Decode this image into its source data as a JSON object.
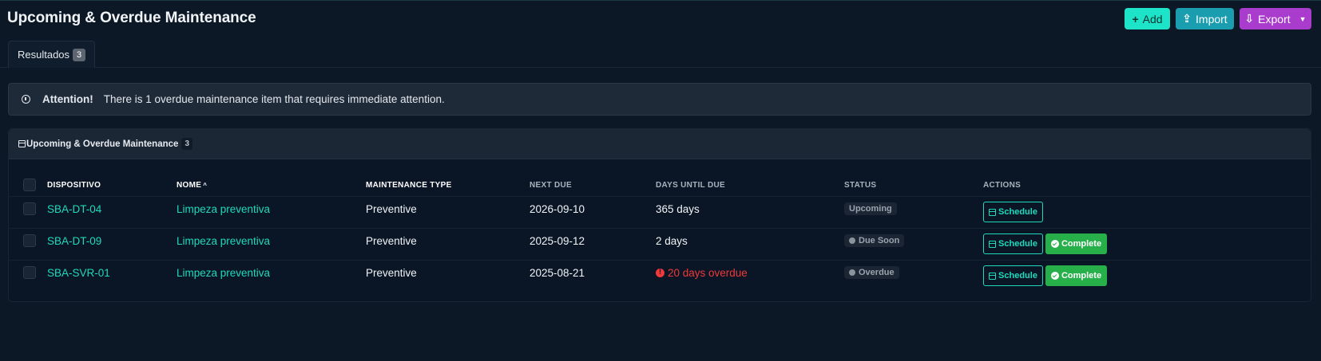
{
  "header": {
    "title": "Upcoming & Overdue Maintenance",
    "add_label": "Add",
    "import_label": "Import",
    "export_label": "Export"
  },
  "tabs": [
    {
      "label": "Resultados",
      "count": "3"
    }
  ],
  "alert": {
    "strong": "Attention!",
    "message": "There is 1 overdue maintenance item that requires immediate attention."
  },
  "card": {
    "title": "Upcoming & Overdue Maintenance",
    "count": "3"
  },
  "table": {
    "columns": {
      "device": "DISPOSITIVO",
      "name": "NOME",
      "name_sort": "^",
      "type": "MAINTENANCE TYPE",
      "next_due": "NEXT DUE",
      "days_until": "DAYS UNTIL DUE",
      "status": "STATUS",
      "actions": "ACTIONS"
    },
    "rows": [
      {
        "device": "SBA-DT-04",
        "name": "Limpeza preventiva",
        "type": "Preventive",
        "next_due": "2026-09-10",
        "days_until": "365 days",
        "overdue": false,
        "status": "Upcoming",
        "status_icon": "",
        "schedule_label": "Schedule",
        "complete_label": ""
      },
      {
        "device": "SBA-DT-09",
        "name": "Limpeza preventiva",
        "type": "Preventive",
        "next_due": "2025-09-12",
        "days_until": "2 days",
        "overdue": false,
        "status": "Due Soon",
        "status_icon": "clock-icon",
        "schedule_label": "Schedule",
        "complete_label": "Complete"
      },
      {
        "device": "SBA-SVR-01",
        "name": "Limpeza preventiva",
        "type": "Preventive",
        "next_due": "2025-08-21",
        "days_until": "20 days overdue",
        "overdue": true,
        "status": "Overdue",
        "status_icon": "alert-icon",
        "schedule_label": "Schedule",
        "complete_label": "Complete"
      }
    ]
  },
  "colors": {
    "accent": "#1fd9bd",
    "add_button": "#1de3c8",
    "import_button": "#1b9db0",
    "export_button": "#a93ccc",
    "complete_button": "#27b04a",
    "overdue": "#f0393a",
    "background": "#0c1826"
  }
}
